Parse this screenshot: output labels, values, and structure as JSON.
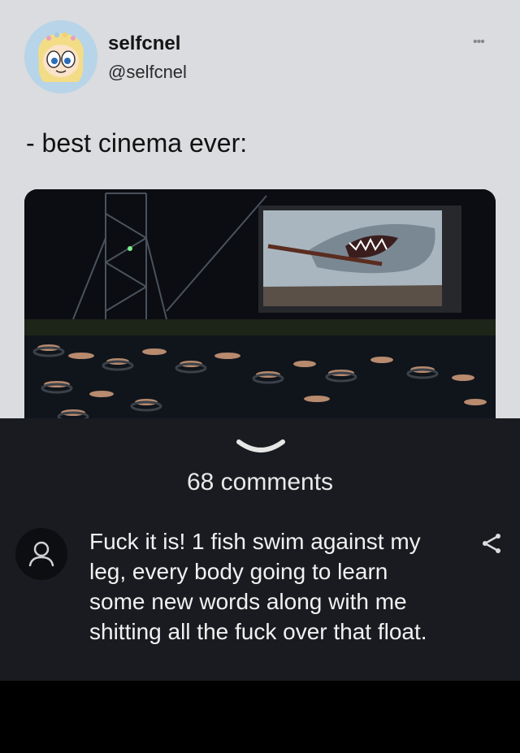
{
  "tweet": {
    "display_name": "selfcnel",
    "handle": "@selfcnel",
    "more_label": "•••",
    "text": "- best cinema ever:",
    "image_icon": "outdoor-float-cinema-photo"
  },
  "comments": {
    "collapse_icon": "chevron-down-icon",
    "count_label": "68 comments",
    "items": [
      {
        "avatar_icon": "user-icon",
        "text": "Fuck it is! 1 fish swim against my leg, every body going to learn some new words along with me shitting all the fuck over that float.",
        "share_icon": "share-icon"
      }
    ]
  },
  "colors": {
    "tweet_background": "#dadcdf",
    "comments_background": "#1a1b20",
    "page_background": "#000000"
  }
}
